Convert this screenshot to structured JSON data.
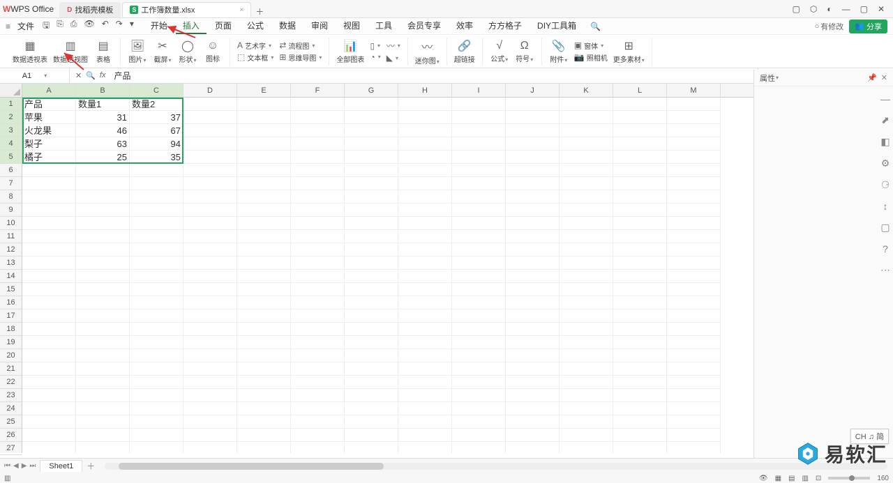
{
  "app_name": "WPS Office",
  "tabs": [
    {
      "label": "找稻壳模板",
      "active": false
    },
    {
      "label": "工作簿数量.xlsx",
      "active": true
    }
  ],
  "file_menu": "文件",
  "main_tabs": [
    "开始",
    "插入",
    "页面",
    "公式",
    "数据",
    "审阅",
    "视图",
    "工具",
    "会员专享",
    "效率",
    "方方格子",
    "DIY工具箱"
  ],
  "active_main_tab": "插入",
  "edit_status": "有修改",
  "share_label": "分享",
  "ribbon": {
    "pivot_table": "数据透视表",
    "pivot_chart": "数据透视图",
    "table": "表格",
    "picture": "图片",
    "screenshot": "截屏",
    "shapes": "形状",
    "icons": "图标",
    "wordart": "艺术字",
    "textbox": "文本框",
    "flowchart": "流程图",
    "mindmap": "思维导图",
    "all_charts": "全部图表",
    "sparkline": "迷你图",
    "hyperlink": "超链接",
    "equation": "公式",
    "symbol": "符号",
    "attachment": "附件",
    "object": "窗体",
    "camera": "照相机",
    "more": "更多素材"
  },
  "name_box": "A1",
  "formula_content": "产品",
  "columns": [
    "A",
    "B",
    "C",
    "D",
    "E",
    "F",
    "G",
    "H",
    "I",
    "J",
    "K",
    "L",
    "M"
  ],
  "rows_visible": 28,
  "data": {
    "headers": [
      "产品",
      "数量1",
      "数量2"
    ],
    "rows": [
      [
        "苹果",
        31,
        37
      ],
      [
        "火龙果",
        46,
        67
      ],
      [
        "梨子",
        63,
        94
      ],
      [
        "橘子",
        25,
        35
      ]
    ]
  },
  "right_panel_title": "属性",
  "sheet_tabs": [
    "Sheet1"
  ],
  "ime_label": "CH ♫ 简",
  "zoom": "160",
  "watermark_text": "易软汇",
  "chart_data": {
    "type": "table",
    "title": "",
    "columns": [
      "产品",
      "数量1",
      "数量2"
    ],
    "rows": [
      {
        "产品": "苹果",
        "数量1": 31,
        "数量2": 37
      },
      {
        "产品": "火龙果",
        "数量1": 46,
        "数量2": 67
      },
      {
        "产品": "梨子",
        "数量1": 63,
        "数量2": 94
      },
      {
        "产品": "橘子",
        "数量1": 25,
        "数量2": 35
      }
    ]
  }
}
